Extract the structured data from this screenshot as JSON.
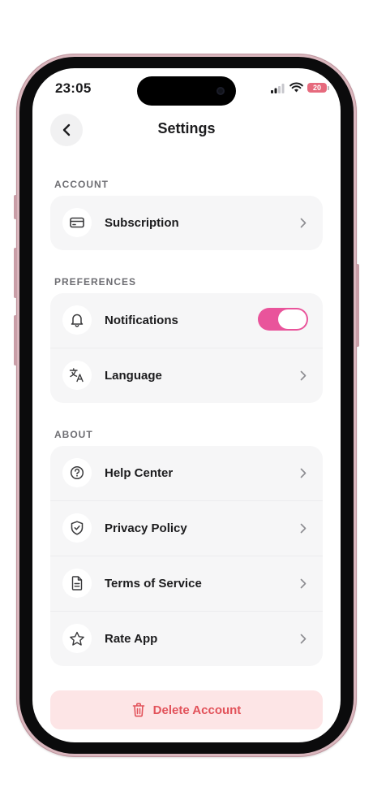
{
  "status_bar": {
    "time": "23:05",
    "battery_level": "20"
  },
  "header": {
    "title": "Settings"
  },
  "sections": {
    "account": {
      "label": "ACCOUNT",
      "items": [
        {
          "label": "Subscription",
          "icon": "credit-card-icon"
        }
      ]
    },
    "preferences": {
      "label": "PREFERENCES",
      "items": [
        {
          "label": "Notifications",
          "icon": "bell-icon",
          "toggle_on": true
        },
        {
          "label": "Language",
          "icon": "translate-icon"
        }
      ]
    },
    "about": {
      "label": "ABOUT",
      "items": [
        {
          "label": "Help Center",
          "icon": "question-circle-icon"
        },
        {
          "label": "Privacy Policy",
          "icon": "shield-check-icon"
        },
        {
          "label": "Terms of Service",
          "icon": "document-icon"
        },
        {
          "label": "Rate App",
          "icon": "star-icon"
        }
      ]
    }
  },
  "delete_account": {
    "label": "Delete Account",
    "icon": "trash-icon"
  },
  "colors": {
    "accent": "#e9549b",
    "danger_text": "#e2525a",
    "danger_bg": "#fde5e6",
    "card_bg": "#f6f6f7",
    "phone_frame": "#d9b6bd"
  }
}
